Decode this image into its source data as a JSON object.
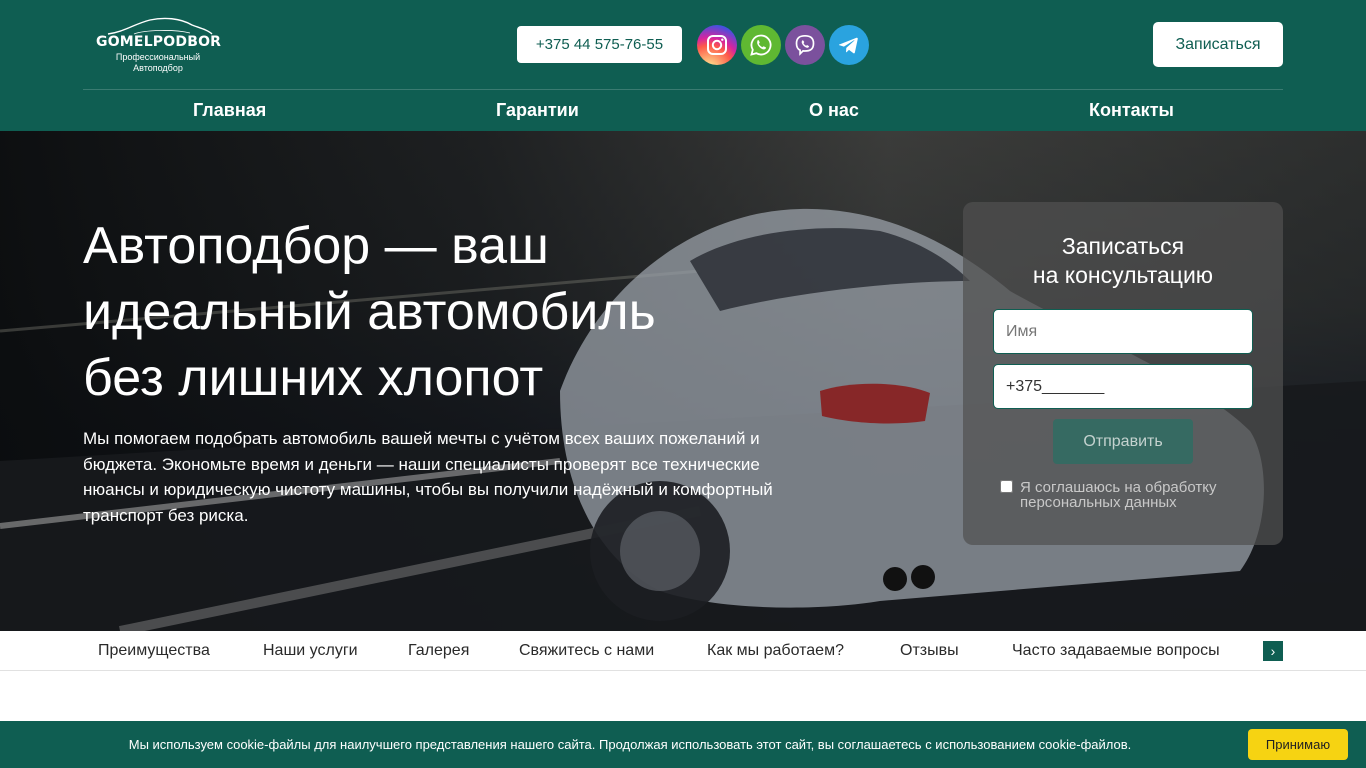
{
  "header": {
    "logo": {
      "name": "GOMELPODBOR",
      "subtitle_line1": "Профессиональный",
      "subtitle_line2": "Автоподбор"
    },
    "phone": "+375 44 575-76-55",
    "socials": [
      "instagram-icon",
      "whatsapp-icon",
      "viber-icon",
      "telegram-icon"
    ],
    "signup_label": "Записаться",
    "nav": [
      "Главная",
      "Гарантии",
      "О нас",
      "Контакты"
    ]
  },
  "hero": {
    "title_line1": "Автоподбор — ваш",
    "title_line2": "идеальный автомобиль",
    "title_line3": "без лишних хлопот",
    "description": "Мы помогаем подобрать автомобиль вашей мечты с учётом всех ваших пожеланий и бюджета. Экономьте время и деньги — наши специалисты проверят все технические нюансы и юридическую чистоту машины, чтобы вы получили надёжный и комфортный транспорт без риска."
  },
  "form": {
    "title_line1": "Записаться",
    "title_line2": "на консультацию",
    "name_placeholder": "Имя",
    "phone_value": "+375_______",
    "submit_label": "Отправить",
    "agree_label": "Я соглашаюсь на обработку персональных данных",
    "agree_checked": false
  },
  "section_nav": {
    "items": [
      "Преимущества",
      "Наши услуги",
      "Галерея",
      "Свяжитесь с нами",
      "Как мы работаем?",
      "Отзывы",
      "Часто задаваемые вопросы"
    ],
    "next_arrow": "›"
  },
  "cookie": {
    "text": "Мы используем cookie-файлы для наилучшего представления нашего сайта. Продолжая использовать этот сайт, вы соглашаетесь с использованием cookie-файлов.",
    "accept_label": "Принимаю"
  },
  "colors": {
    "brand_green": "#0f5e52",
    "cookie_button": "#f6d312"
  }
}
